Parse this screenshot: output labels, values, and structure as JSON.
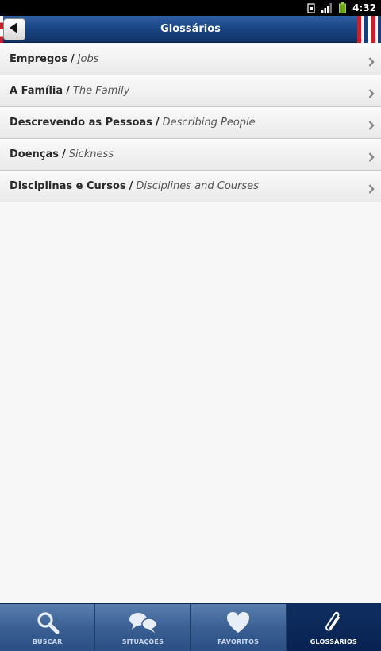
{
  "status_bar": {
    "time": "4:32"
  },
  "header": {
    "title": "Glossários"
  },
  "glossaries": [
    {
      "pt": "Empregos",
      "en": "Jobs"
    },
    {
      "pt": "A Família",
      "en": "The Family"
    },
    {
      "pt": "Descrevendo as Pessoas",
      "en": "Describing People"
    },
    {
      "pt": "Doenças",
      "en": "Sickness"
    },
    {
      "pt": "Disciplinas e Cursos",
      "en": "Disciplines and Courses"
    }
  ],
  "separator": "/",
  "tabs": [
    {
      "label": "BUSCAR",
      "icon": "search-icon"
    },
    {
      "label": "SITUAÇÕES",
      "icon": "chat-bubbles-icon"
    },
    {
      "label": "FAVORITOS",
      "icon": "heart-icon"
    },
    {
      "label": "GLOSSÁRIOS",
      "icon": "paperclip-icon",
      "active": true
    }
  ],
  "colors": {
    "header_blue": "#17427f",
    "tab_blue": "#3a5f93",
    "active_tab": "#082252"
  }
}
